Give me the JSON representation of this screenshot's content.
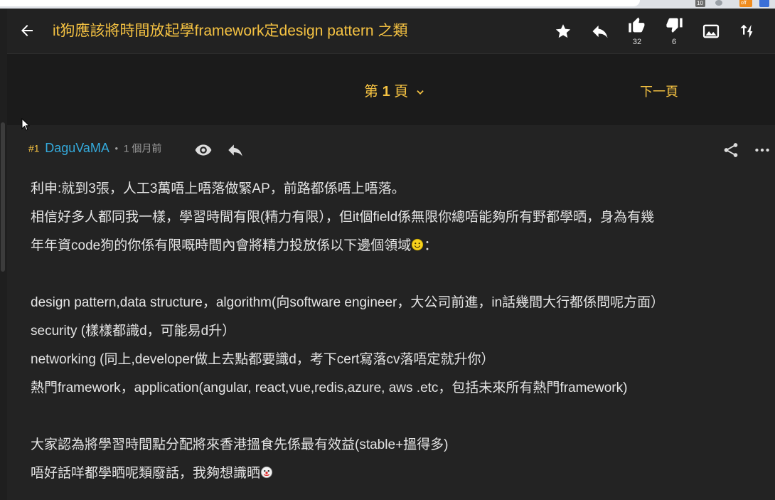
{
  "browser": {
    "ext_badge_count": "10",
    "ext_off_label": "off"
  },
  "header": {
    "title": "it狗應該將時間放起學framework定design pattern 之類",
    "like_count": "32",
    "dislike_count": "6",
    "icons": [
      "back-arrow-icon",
      "star-icon",
      "reply-icon",
      "thumbs-up-icon",
      "thumbs-down-icon",
      "image-icon",
      "sort-icon"
    ]
  },
  "pager": {
    "page_prefix": "第",
    "page_number": "1",
    "page_suffix": "頁",
    "next_label": "下一頁"
  },
  "post": {
    "floor": "#1",
    "username": "DaguVaMA",
    "separator": "•",
    "time": "1 個月前",
    "lines": [
      "利申:就到3張，人工3萬唔上唔落做緊AP，前路都係唔上唔落。",
      "相信好多人都同我一樣，學習時間有限(精力有限），但it個field係無限你總唔能夠所有野都學晒，身為有幾",
      "年年資code狗的你係有限嘅時間內會將精力投放係以下邊個領域",
      "：",
      "",
      "design pattern,data structure，algorithm(向software engineer，大公司前進，in話幾間大行都係問呢方面）",
      "security (樣樣都識d，可能易d升）",
      "networking (同上,developer做上去點都要識d，考下cert寫落cv落唔定就升你）",
      "熱門framework，application(angular, react,vue,redis,azure, aws .etc，包括未來所有熱門framework)",
      "",
      "大家認為將學習時間點分配將來香港搵食先係最有效益(stable+搵得多)",
      "唔好話咩都學晒呢類廢話，我夠想識晒"
    ],
    "accent_colors": {
      "title": "#f5c242",
      "username": "#34aadc"
    }
  }
}
